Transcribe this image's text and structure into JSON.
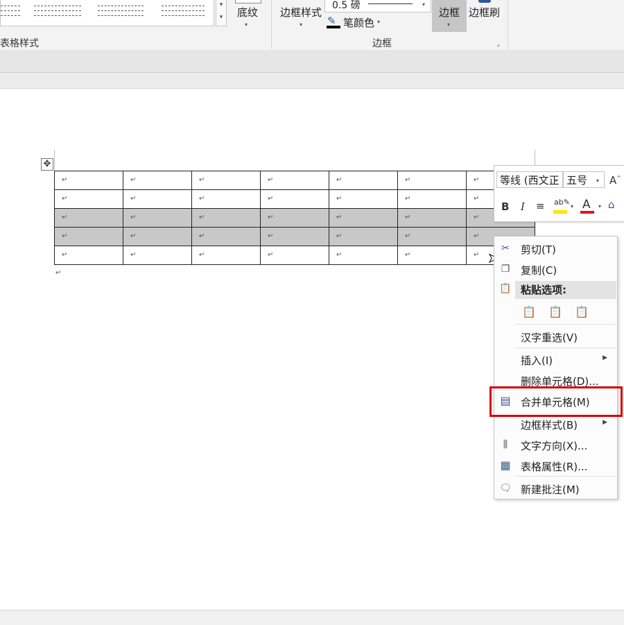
{
  "ribbon": {
    "table_styles_label": "表格样式",
    "shading_label": "底纹",
    "border_styles_label": "边框样式",
    "pen_weight": "0.5 磅",
    "pen_color_label": "笔颜色",
    "borders_label": "边框",
    "border_painter_label": "边框刷",
    "borders_group_label": "边框"
  },
  "document": {
    "cell_mark": "↵",
    "rows": 5,
    "cols": 7,
    "selected_rows": [
      3,
      4
    ]
  },
  "mini_toolbar": {
    "font_name": "等线 (西文正",
    "font_size": "五号",
    "bold": "B",
    "italic": "I",
    "font_color_letter": "A",
    "grow_font": "A"
  },
  "context_menu": {
    "cut": "剪切(T)",
    "copy": "复制(C)",
    "paste_options": "粘贴选项:",
    "reconvert": "汉字重选(V)",
    "insert": "插入(I)",
    "delete_cells": "删除单元格(D)...",
    "merge_cells": "合并单元格(M)",
    "border_styles": "边框样式(B)",
    "text_direction": "文字方向(X)...",
    "table_properties": "表格属性(R)...",
    "new_comment": "新建批注(M)"
  },
  "colors": {
    "highlight_box": "#d40000",
    "selection": "#c8c8c8",
    "highlighter_yellow": "#ffe600",
    "font_color_red": "#e81123"
  }
}
